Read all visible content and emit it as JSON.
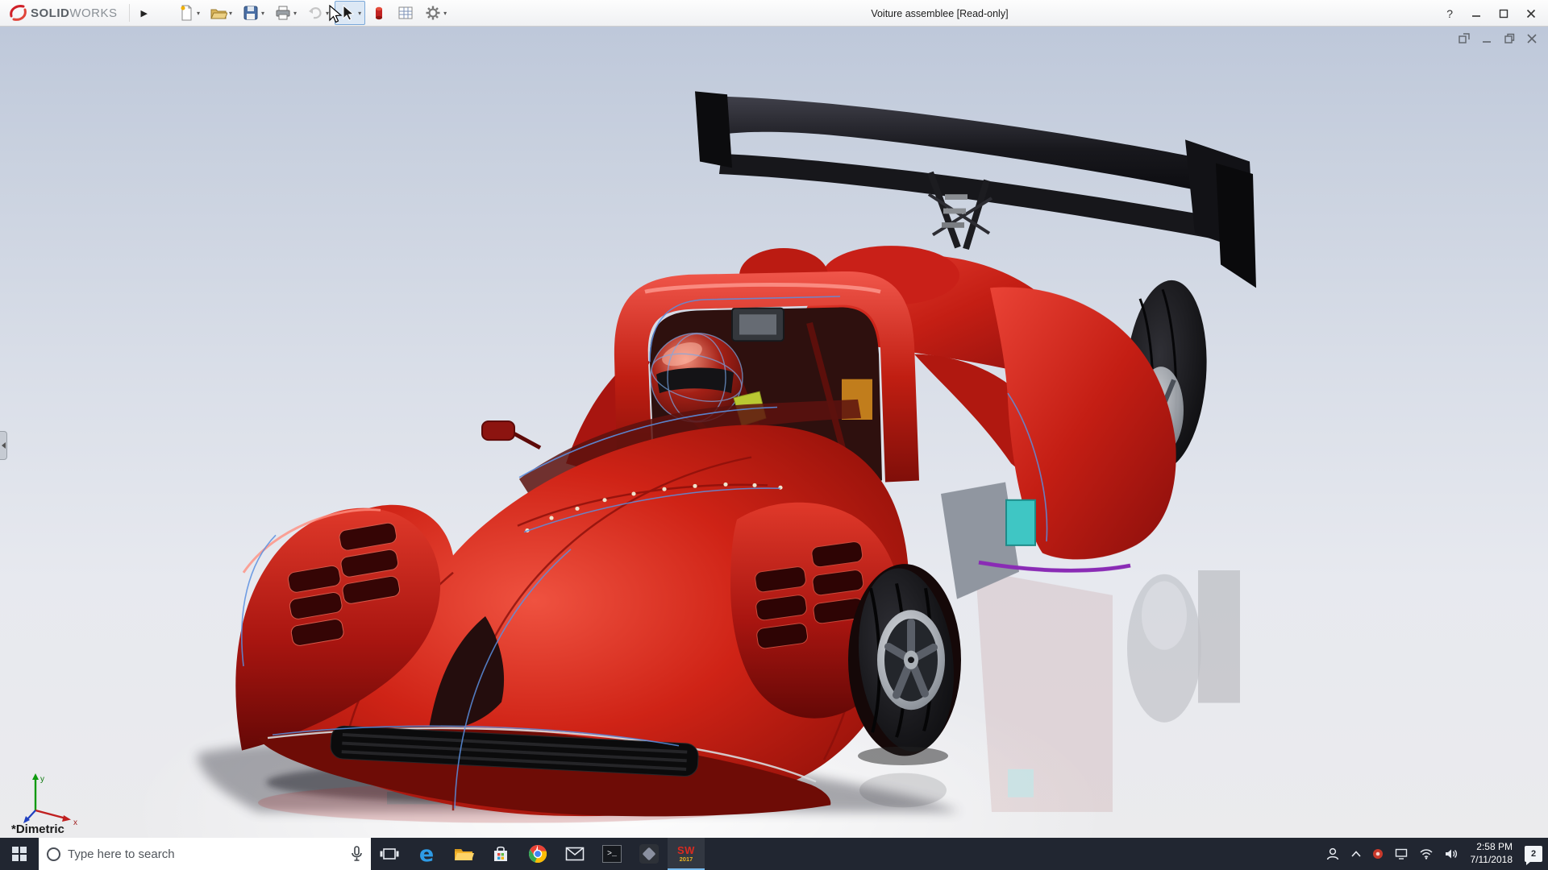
{
  "titlebar": {
    "logo_primary": "SOLID",
    "logo_secondary": "WORKS",
    "menu_expand_glyph": "▶",
    "title": "Voiture assemblee [Read-only]",
    "help_label": "?"
  },
  "toolbar": {
    "icons": [
      "new-document",
      "open-document",
      "save",
      "print",
      "undo",
      "select-cursor",
      "macro-record",
      "design-table",
      "options-gear"
    ],
    "selected_tool": "select-cursor"
  },
  "viewport": {
    "orientation_label": "*Dimetric",
    "axis_x_label": "x",
    "axis_y_label": "y",
    "window_controls": [
      "float-window",
      "minimize-window",
      "restore-window",
      "close-window"
    ],
    "colors": {
      "body_red": "#c41e14",
      "wing_black": "#121216",
      "background_top": "#bec8da",
      "background_bottom": "#ebebed"
    }
  },
  "taskbar": {
    "search_placeholder": "Type here to search",
    "apps": [
      "start",
      "search",
      "task-view",
      "edge",
      "file-explorer",
      "store",
      "chrome",
      "mail",
      "console",
      "viewer",
      "solidworks"
    ],
    "edge_letter": "e",
    "console_glyph": ">_",
    "sw_label": "SW",
    "sw_year": "2017",
    "tray": {
      "time": "2:58 PM",
      "date": "7/11/2018",
      "notification_count": "2"
    }
  }
}
